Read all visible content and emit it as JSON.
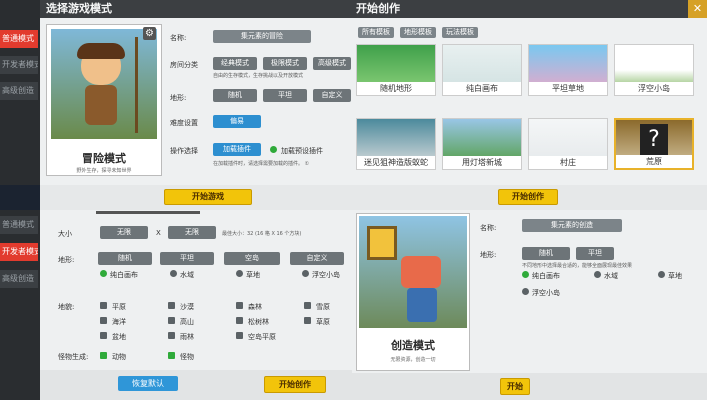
{
  "left_panel": {
    "title": "选择游戏模式",
    "sidebar": [
      "普通模式",
      "开发者模式",
      "高级创造"
    ],
    "card": {
      "title": "冒险模式",
      "subtitle": "野外生存，探寻未知世界"
    },
    "form": {
      "name_label": "名称:",
      "name_value": "集元素的冒险",
      "room_label": "房间分类",
      "room_options": [
        "经典模式",
        "极限模式",
        "高级模式"
      ],
      "room_hint": "自由的生存模式，生存挑战以及开放模式",
      "terrain_label": "地形:",
      "terrain_options": [
        "随机",
        "平坦",
        "自定义"
      ],
      "difficulty_label": "难度设置",
      "difficulty_value": "偏易",
      "op_label": "操作选择",
      "op_value": "加载插件",
      "preset_label": "加载预设插件",
      "op_hint": "在加载插件时，请选择需要加载的插件。 ①"
    },
    "start_button": "开始游戏"
  },
  "right_panel": {
    "title": "开始创作",
    "tabs": [
      "所有模板",
      "地形模板",
      "玩法模板"
    ],
    "templates": [
      {
        "label": "随机地形",
        "colors": [
          "#3fa04a",
          "#8fd27c"
        ]
      },
      {
        "label": "纯白画布",
        "colors": [
          "#e8f0f0",
          "#cfe0e0"
        ]
      },
      {
        "label": "平坦草地",
        "colors": [
          "#7ac8f0",
          "#f0a6c6"
        ]
      },
      {
        "label": "浮空小岛",
        "colors": [
          "#ffffff",
          "#6aa843"
        ]
      },
      {
        "label": "迷见狙神造版蚁蛇",
        "colors": [
          "#4c8a9c",
          "#e0e0e0"
        ]
      },
      {
        "label": "用灯塔新城",
        "colors": [
          "#99c6e6",
          "#4f9b3a"
        ]
      },
      {
        "label": "村庄",
        "colors": [
          "#f4f6f7",
          "#e4e8ea"
        ]
      },
      {
        "label": "荒原",
        "colors": [
          "#8b6a2c",
          "#d4c4a0"
        ]
      }
    ],
    "start_button": "开始创作"
  },
  "bottom_left": {
    "sidebar": [
      "普通模式",
      "开发者模式",
      "高级创造"
    ],
    "size_label": "大小",
    "size_w": "无限",
    "size_x": "X",
    "size_h": "无限",
    "size_hint": "最佳大小：32 (16 格 X 16 个方块)",
    "terrain_label": "地形:",
    "terrain_options": [
      "随机",
      "平坦",
      "空岛",
      "自定义"
    ],
    "biome_radios": [
      "纯白画布",
      "水域",
      "草地",
      "浮空小岛"
    ],
    "features_label": "地貌:",
    "features": [
      "平原",
      "沙漠",
      "森林",
      "雪原",
      "海洋",
      "高山",
      "松树林",
      "草原",
      "盆地",
      "雨林",
      "空岛平原"
    ],
    "creature_label": "怪物生成:",
    "creature_options": [
      "动物",
      "怪物"
    ],
    "reset_button": "恢复默认",
    "start_button": "开始创作"
  },
  "bottom_right": {
    "card": {
      "title": "创造模式",
      "subtitle": "无限资源，创造一切"
    },
    "name_label": "名称:",
    "name_value": "集元素的创造",
    "terrain_label": "地形:",
    "terrain_options": [
      "随机",
      "平坦"
    ],
    "terrain_hint": "不同地形中选择最合适的，能够全面展现最佳效果",
    "biome_radios": [
      "纯白画布",
      "水域",
      "草地",
      "浮空小岛"
    ],
    "start_button": "开始"
  }
}
